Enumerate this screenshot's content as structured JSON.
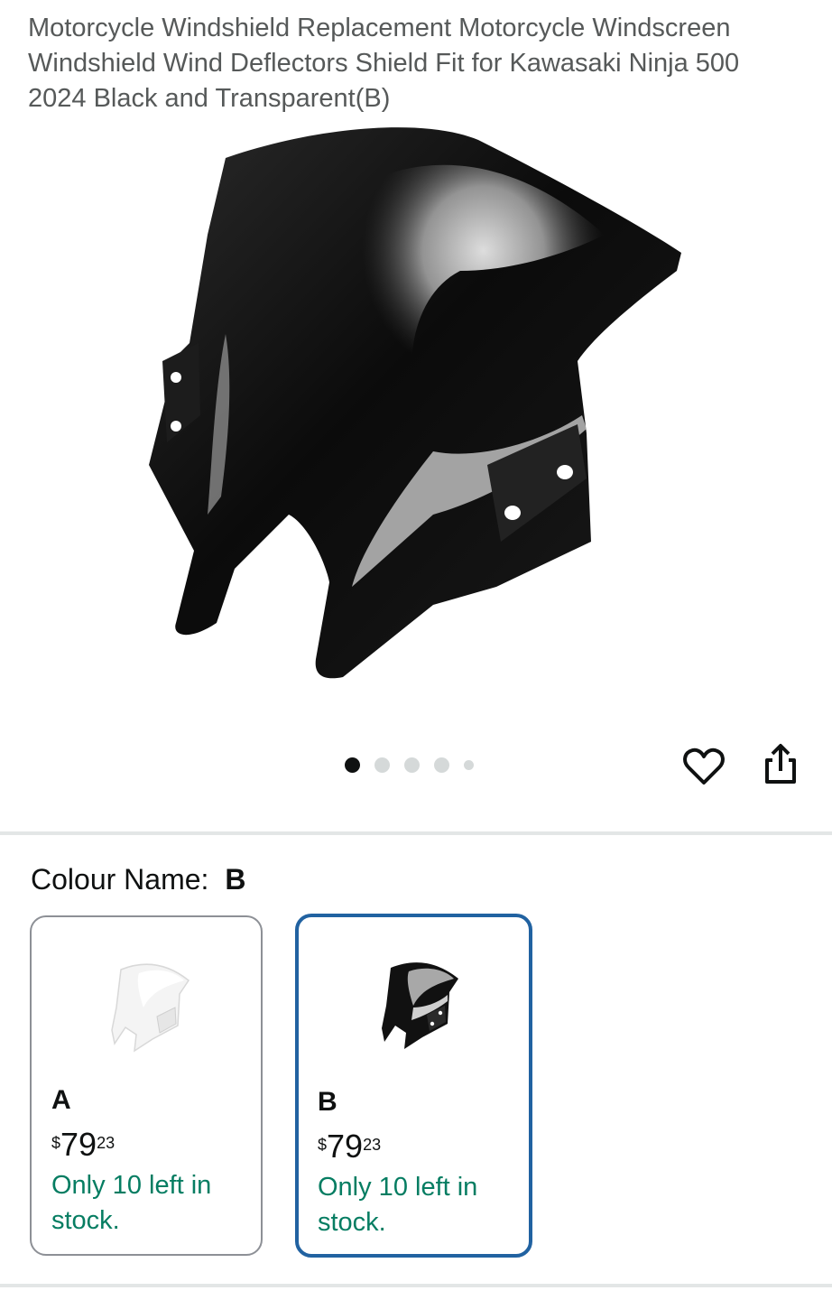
{
  "product": {
    "title": "Motorcycle Windshield Replacement Motorcycle Windscreen Windshield Wind Deflectors Shield Fit for Kawasaki Ninja 500 2024 Black and Transparent(B)"
  },
  "gallery": {
    "image_count": 5,
    "active_index": 0
  },
  "icons": {
    "wishlist": "heart-icon",
    "share": "share-icon"
  },
  "colour": {
    "label": "Colour Name:",
    "selected_value": "B"
  },
  "options": [
    {
      "name": "A",
      "currency": "$",
      "price_whole": "79",
      "price_fraction": "23",
      "stock": "Only 10 left in stock."
    },
    {
      "name": "B",
      "currency": "$",
      "price_whole": "79",
      "price_fraction": "23",
      "stock": "Only 10 left in stock."
    }
  ],
  "colors": {
    "stock_green": "#067d62",
    "selected_border": "#2162a1",
    "title_gray": "#565959"
  }
}
